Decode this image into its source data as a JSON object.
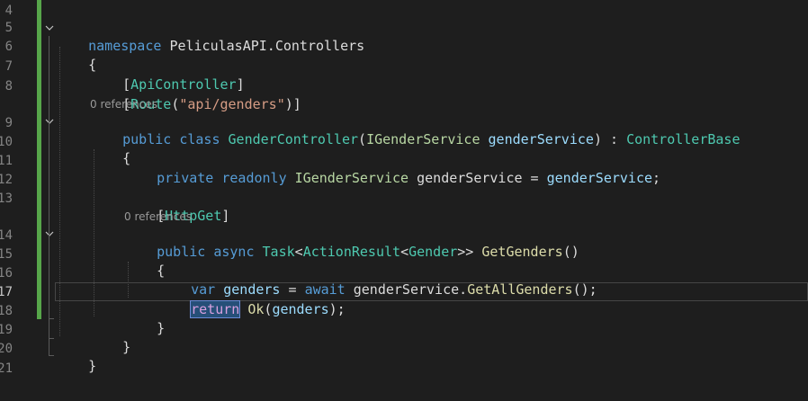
{
  "gutter": {
    "line_numbers": [
      "4",
      "5",
      "6",
      "7",
      "8",
      "9",
      "10",
      "11",
      "12",
      "13",
      "14",
      "15",
      "16",
      "17",
      "18",
      "19",
      "20",
      "21"
    ],
    "active_line": "17"
  },
  "code": {
    "namespace_kw": "namespace",
    "namespace_name": "PeliculasAPI.Controllers",
    "open_brace": "{",
    "close_brace": "}",
    "attr_api_controller": "ApiController",
    "attr_route": "Route",
    "route_value": "\"api/genders\"",
    "lens_class_refs": "0 references",
    "kw_public": "public",
    "kw_class": "class",
    "class_name": "GenderController",
    "service_interface": "IGenderService",
    "param_name": "genderService",
    "base_class": "ControllerBase",
    "kw_private": "private",
    "kw_readonly": "readonly",
    "field_name": "genderService",
    "attr_http_get": "HttpGet",
    "lens_method_refs": "0 references",
    "kw_async": "async",
    "type_task": "Task",
    "type_action_result": "ActionResult",
    "type_gender": "Gender",
    "method_name": "GetGenders",
    "kw_var": "var",
    "local_var": "genders",
    "kw_await": "await",
    "call_get_all": "GetAllGenders",
    "kw_return": "return",
    "call_ok": "Ok"
  },
  "colors": {
    "background": "#1e1e1e",
    "keyword": "#569cd6",
    "control_keyword": "#d8a0df",
    "type": "#4ec9b0",
    "interface": "#b8d7a3",
    "string": "#d69d85",
    "method": "#dcdcaa",
    "variable": "#9cdcfe",
    "change_bar": "#57a64a"
  }
}
